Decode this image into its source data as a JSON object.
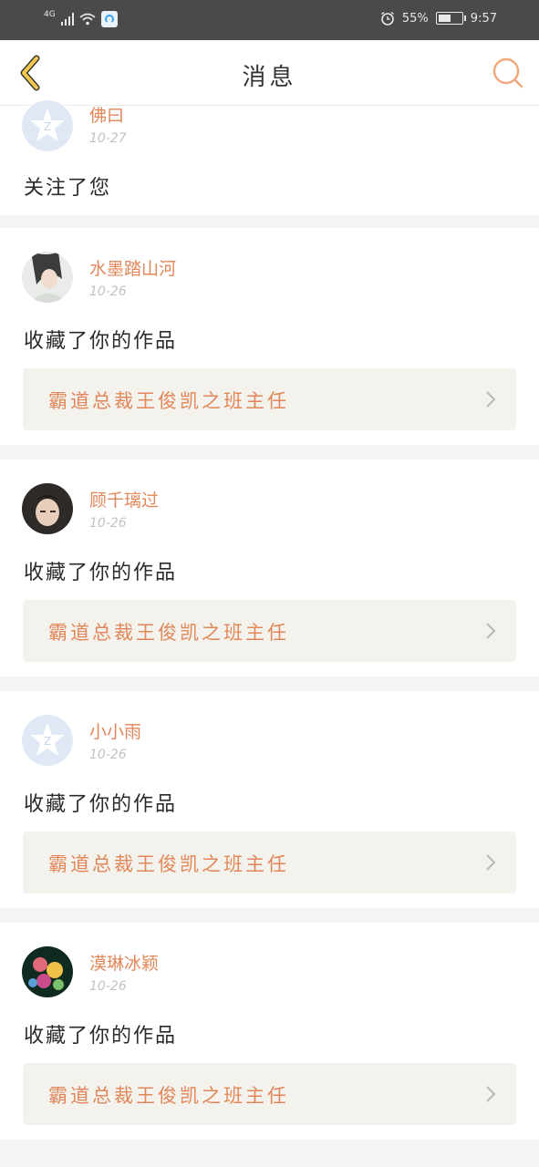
{
  "status_bar": {
    "network": "4G",
    "battery_percent": "55%",
    "battery_level": 0.55,
    "time": "9:57"
  },
  "header": {
    "title": "消息"
  },
  "notifications": [
    {
      "username": "佛曰",
      "date": "10-27",
      "action": "关注了您",
      "avatar": "default-avatar-icon",
      "work_title": null
    },
    {
      "username": "水墨踏山河",
      "date": "10-26",
      "action": "收藏了你的作品",
      "avatar": "user-photo-1",
      "work_title": "霸道总裁王俊凯之班主任"
    },
    {
      "username": "顾千璃过",
      "date": "10-26",
      "action": "收藏了你的作品",
      "avatar": "user-photo-2",
      "work_title": "霸道总裁王俊凯之班主任"
    },
    {
      "username": "小小雨",
      "date": "10-26",
      "action": "收藏了你的作品",
      "avatar": "default-avatar-icon",
      "work_title": "霸道总裁王俊凯之班主任"
    },
    {
      "username": "漠琳冰颖",
      "date": "10-26",
      "action": "收藏了你的作品",
      "avatar": "user-photo-3",
      "work_title": "霸道总裁王俊凯之班主任"
    }
  ],
  "colors": {
    "accent": "#e2875a",
    "back_icon": "#f2c94c",
    "status_bar": "#4a4a4a",
    "link_card_bg": "#f3f2ec"
  }
}
